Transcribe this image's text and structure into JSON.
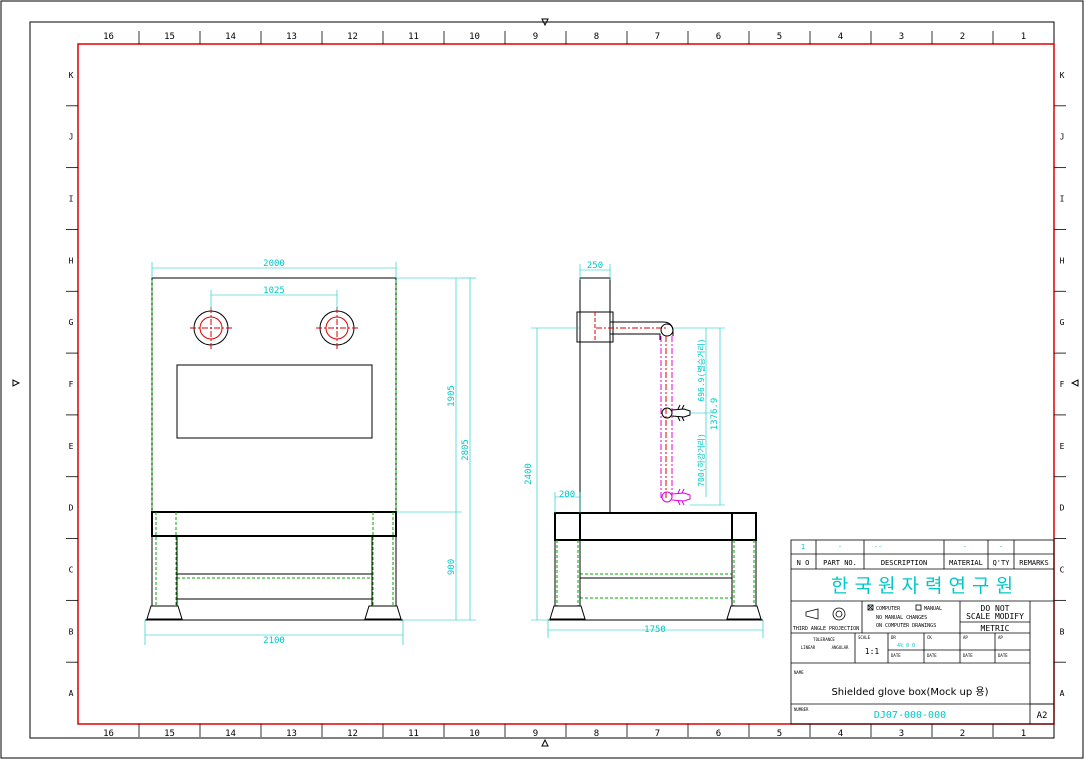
{
  "border": {
    "column_labels_top": [
      "16",
      "15",
      "14",
      "13",
      "12",
      "11",
      "10",
      "9",
      "8",
      "7",
      "6",
      "5",
      "4",
      "3",
      "2",
      "1"
    ],
    "column_labels_bottom": [
      "16",
      "15",
      "14",
      "13",
      "12",
      "11",
      "10",
      "9",
      "8",
      "7",
      "6",
      "5",
      "4",
      "3",
      "2",
      "1"
    ],
    "row_labels": [
      "K",
      "J",
      "I",
      "H",
      "G",
      "F",
      "E",
      "D",
      "C",
      "B",
      "A"
    ]
  },
  "front_view": {
    "dims": {
      "width_top": "2000",
      "port_spacing": "1025",
      "cabinet_height": "1905",
      "total_height": "2805",
      "stand_height": "900",
      "base_width": "2100"
    }
  },
  "side_view": {
    "dims": {
      "column_width": "250",
      "height": "2400",
      "leg_width": "200",
      "depth": "1750",
      "arm_reach": "1376.9",
      "range_1": "696.9(별승거리)",
      "range_2": "700(하강거리)"
    }
  },
  "title_block": {
    "row1": [
      "1",
      "-",
      "--",
      "-",
      "-"
    ],
    "headers": [
      "N O",
      "PART NO.",
      "DESCRIPTION",
      "MATERIAL",
      "Q'TY",
      "REMARKS"
    ],
    "org_name": "한 국 원 자 력 연 구 원",
    "projection_label": "THIRD ANGLE PROJECTION",
    "computer_label": "COMPUTER",
    "manual_label": "MANUAL",
    "note_1": "NO MANUAL CHANGES",
    "note_2": "ON COMPUTER DRAWINGS",
    "do_not_scale_1": "DO NOT",
    "do_not_scale_2": "SCALE MODIFY",
    "units": "METRIC",
    "tolerance_label": "TOLERANCE",
    "linear_label": "LINEAR",
    "angular_label": "ANGULAR",
    "scale_label": "SCALE",
    "scale_value": "1:1",
    "dr_label": "DR",
    "dr_name": "4% 0 0",
    "ck_label": "CK",
    "ap_label": "AP",
    "date_label": "DATE",
    "name_label": "NAME",
    "drawing_name": "Shielded glove box(Mock up 용)",
    "number_label": "NUMBER",
    "drawing_number": "DJ07-000-000",
    "sheet_size": "A2"
  },
  "colors": {
    "frame": "#e00000",
    "outline": "#000000",
    "dimension": "#00c8c8",
    "hidden": "#00aa00",
    "manipulator": "#e000e0"
  }
}
